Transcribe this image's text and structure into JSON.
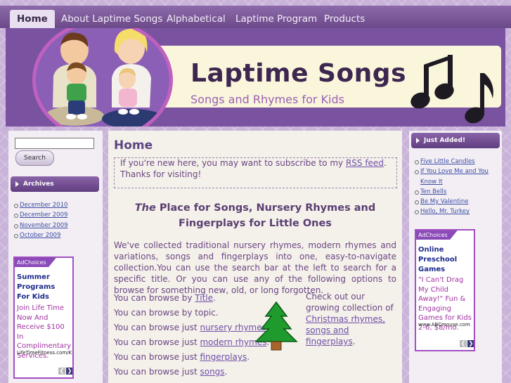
{
  "nav": {
    "items": [
      {
        "label": "Home",
        "active": true
      },
      {
        "label": "About Laptime Songs"
      },
      {
        "label": "Alphabetical"
      },
      {
        "label": "Laptime Program"
      },
      {
        "label": "Products"
      }
    ]
  },
  "header": {
    "title": "Laptime Songs",
    "tagline": "Songs and Rhymes for Kids",
    "icons": [
      "family-illustration-icon",
      "music-notes-icon"
    ]
  },
  "sidebar_left": {
    "search": {
      "placeholder": "",
      "button_label": "Search"
    },
    "archives": {
      "title": "Archives",
      "items": [
        "December 2010",
        "December 2009",
        "November 2009",
        "October 2009"
      ]
    },
    "ad": {
      "badge": "AdChoices",
      "title": "Summer Programs For Kids",
      "text": "Join Life Time Now And Receive $100 In Complimentary Services.",
      "url": "LifeTimeFitness.com/K..."
    }
  },
  "sidebar_right": {
    "just_added": {
      "title": "Just Added!",
      "items": [
        "Five Little Candles",
        "If You Love Me and You Know It",
        "Ten Bells",
        "Be My Valentine",
        "Hello, Mr. Turkey"
      ]
    },
    "ad": {
      "badge": "AdChoices",
      "title": "Online Preschool Games",
      "text": "\"I Can't Drag My Child Away!\" Fun & Engaging Games for Kids 2-6, $8/mo.",
      "url": "www.ABCmouse.com"
    }
  },
  "main": {
    "title": "Home",
    "notice": {
      "before": "If you're new here, you may want to subscribe to my ",
      "link": "RSS feed",
      "after": ". Thanks for visiting!"
    },
    "headline": {
      "emph": "The",
      "rest1": " Place for Songs, Nursery Rhymes and",
      "rest2": "Fingerplays for Little Ones"
    },
    "intro": "We've collected traditional nursery rhymes, modern rhymes and variations, songs and fingerplays into one, easy-to-navigate collection.You can use the search bar at the left to search for a specific title. Or you can use any of the following options to browse for something new, old, or long forgotten.",
    "browse": [
      {
        "prefix": "You can browse by ",
        "link": "Title",
        "suffix": "."
      },
      {
        "prefix": "You can browse by topic.",
        "link": "",
        "suffix": ""
      },
      {
        "prefix": "You can browse just ",
        "link": "nursery rhymes",
        "suffix": "."
      },
      {
        "prefix": "You can browse just ",
        "link": "modern rhymes",
        "suffix": "."
      },
      {
        "prefix": "You can browse just ",
        "link": "fingerplays",
        "suffix": "."
      },
      {
        "prefix": "You can browse just ",
        "link": "songs",
        "suffix": "."
      }
    ],
    "xmas": {
      "before": "Check out our growing collection of ",
      "link": "Christmas rhymes, songs and fingerplays",
      "after": "."
    }
  }
}
